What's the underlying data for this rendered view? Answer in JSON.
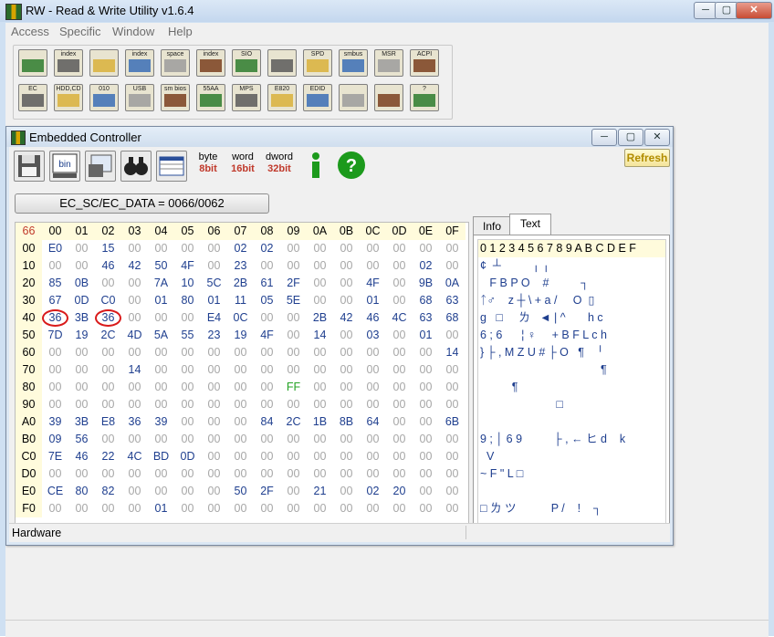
{
  "window": {
    "title": "RW - Read & Write Utility v1.6.4",
    "min_label": "▭",
    "max_label": "▢",
    "close_label": "✕"
  },
  "menu": {
    "items": [
      "Access",
      "Specific",
      "Window",
      "Help"
    ]
  },
  "toolbar": {
    "row1": [
      {
        "icon": "pci-card-icon",
        "label": ""
      },
      {
        "icon": "pci-index-icon",
        "label": "index"
      },
      {
        "icon": "memory-icon",
        "label": ""
      },
      {
        "icon": "memory-index-icon",
        "label": "index"
      },
      {
        "icon": "io-space-icon",
        "label": "space"
      },
      {
        "icon": "io-index-icon",
        "label": "index"
      },
      {
        "icon": "sio-icon",
        "label": "SIO"
      },
      {
        "icon": "oscilloscope-icon",
        "label": ""
      },
      {
        "icon": "spd-icon",
        "label": "SPD"
      },
      {
        "icon": "smbus-icon",
        "label": "smbus"
      },
      {
        "icon": "msr-icon",
        "label": "MSR"
      },
      {
        "icon": "acpi-icon",
        "label": "ACPI"
      }
    ],
    "row2": [
      {
        "icon": "ec-icon",
        "label": "EC"
      },
      {
        "icon": "hdd-cd-icon",
        "label": "HDD,CD"
      },
      {
        "icon": "disk-010-icon",
        "label": "010"
      },
      {
        "icon": "usb-icon",
        "label": "USB"
      },
      {
        "icon": "smbios-icon",
        "label": "sm bios"
      },
      {
        "icon": "55aa-icon",
        "label": "55AA"
      },
      {
        "icon": "mps-icon",
        "label": "MPS"
      },
      {
        "icon": "e820-icon",
        "label": "E820"
      },
      {
        "icon": "edid-icon",
        "label": "EDID"
      },
      {
        "icon": "command-icon",
        "label": ""
      },
      {
        "icon": "hardware-icon",
        "label": ""
      },
      {
        "icon": "help-icon",
        "label": "?"
      }
    ]
  },
  "child": {
    "title": "Embedded Controller",
    "refresh_label": "Refresh",
    "size_buttons": [
      {
        "top": "byte",
        "bottom": "8bit",
        "color": "#c0392b"
      },
      {
        "top": "word",
        "bottom": "16bit",
        "color": "#c0392b"
      },
      {
        "top": "dword",
        "bottom": "32bit",
        "color": "#c0392b"
      }
    ],
    "ec_label": "EC_SC/EC_DATA = 0066/0062",
    "tabs": [
      "Info",
      "Text"
    ],
    "active_tab": "Text",
    "status": "Hardware"
  },
  "grid": {
    "corner": "66",
    "columns": [
      "00",
      "01",
      "02",
      "03",
      "04",
      "05",
      "06",
      "07",
      "08",
      "09",
      "0A",
      "0B",
      "0C",
      "0D",
      "0E",
      "0F"
    ],
    "rows": [
      {
        "addr": "00",
        "cells": [
          "E0",
          "00",
          "15",
          "00",
          "00",
          "00",
          "00",
          "02",
          "02",
          "00",
          "00",
          "00",
          "00",
          "00",
          "00",
          "00"
        ]
      },
      {
        "addr": "10",
        "cells": [
          "00",
          "00",
          "46",
          "42",
          "50",
          "4F",
          "00",
          "23",
          "00",
          "00",
          "00",
          "00",
          "00",
          "00",
          "02",
          "00"
        ]
      },
      {
        "addr": "20",
        "cells": [
          "85",
          "0B",
          "00",
          "00",
          "7A",
          "10",
          "5C",
          "2B",
          "61",
          "2F",
          "00",
          "00",
          "4F",
          "00",
          "9B",
          "0A"
        ]
      },
      {
        "addr": "30",
        "cells": [
          "67",
          "0D",
          "C0",
          "00",
          "01",
          "80",
          "01",
          "11",
          "05",
          "5E",
          "00",
          "00",
          "01",
          "00",
          "68",
          "63"
        ]
      },
      {
        "addr": "40",
        "cells": [
          "36",
          "3B",
          "36",
          "00",
          "00",
          "00",
          "E4",
          "0C",
          "00",
          "00",
          "2B",
          "42",
          "46",
          "4C",
          "63",
          "68"
        ]
      },
      {
        "addr": "50",
        "cells": [
          "7D",
          "19",
          "2C",
          "4D",
          "5A",
          "55",
          "23",
          "19",
          "4F",
          "00",
          "14",
          "00",
          "03",
          "00",
          "01",
          "00"
        ]
      },
      {
        "addr": "60",
        "cells": [
          "00",
          "00",
          "00",
          "00",
          "00",
          "00",
          "00",
          "00",
          "00",
          "00",
          "00",
          "00",
          "00",
          "00",
          "00",
          "14"
        ]
      },
      {
        "addr": "70",
        "cells": [
          "00",
          "00",
          "00",
          "14",
          "00",
          "00",
          "00",
          "00",
          "00",
          "00",
          "00",
          "00",
          "00",
          "00",
          "00",
          "00"
        ]
      },
      {
        "addr": "80",
        "cells": [
          "00",
          "00",
          "00",
          "00",
          "00",
          "00",
          "00",
          "00",
          "00",
          "FF",
          "00",
          "00",
          "00",
          "00",
          "00",
          "00"
        ]
      },
      {
        "addr": "90",
        "cells": [
          "00",
          "00",
          "00",
          "00",
          "00",
          "00",
          "00",
          "00",
          "00",
          "00",
          "00",
          "00",
          "00",
          "00",
          "00",
          "00"
        ]
      },
      {
        "addr": "A0",
        "cells": [
          "39",
          "3B",
          "E8",
          "36",
          "39",
          "00",
          "00",
          "00",
          "84",
          "2C",
          "1B",
          "8B",
          "64",
          "00",
          "00",
          "6B"
        ]
      },
      {
        "addr": "B0",
        "cells": [
          "09",
          "56",
          "00",
          "00",
          "00",
          "00",
          "00",
          "00",
          "00",
          "00",
          "00",
          "00",
          "00",
          "00",
          "00",
          "00"
        ]
      },
      {
        "addr": "C0",
        "cells": [
          "7E",
          "46",
          "22",
          "4C",
          "BD",
          "0D",
          "00",
          "00",
          "00",
          "00",
          "00",
          "00",
          "00",
          "00",
          "00",
          "00"
        ]
      },
      {
        "addr": "D0",
        "cells": [
          "00",
          "00",
          "00",
          "00",
          "00",
          "00",
          "00",
          "00",
          "00",
          "00",
          "00",
          "00",
          "00",
          "00",
          "00",
          "00"
        ]
      },
      {
        "addr": "E0",
        "cells": [
          "CE",
          "80",
          "82",
          "00",
          "00",
          "00",
          "00",
          "50",
          "2F",
          "00",
          "21",
          "00",
          "02",
          "20",
          "00",
          "00"
        ]
      },
      {
        "addr": "F0",
        "cells": [
          "00",
          "00",
          "00",
          "00",
          "01",
          "00",
          "00",
          "00",
          "00",
          "00",
          "00",
          "00",
          "00",
          "00",
          "00",
          "00"
        ]
      }
    ],
    "highlight_color": "#24a324",
    "circle_color": "#d91a1a"
  },
  "text_panel": {
    "header": "0 1 2 3 4 5 6 7 8 9 A B C D E F",
    "rows": [
      "¢  ┴          ╷ ╷",
      "   F B P O    #          ┐",
      "ᛏ♂    z ┼ \\ + a /     O  ▯",
      "g   □     ㄌ   ◄ | ^       h c",
      "6 ; 6      ¦ ♀     + B F L c h",
      "} ├ , M Z U # ├ O   ¶    ╵",
      "                                      ¶",
      "          ¶",
      "                        □",
      "",
      "9 ; │ 6 9          ├ , ← ヒ d    k",
      "  V",
      "~ F \" L □",
      "",
      "□ ㄌ ツ           P /    !    ┐",
      ""
    ]
  }
}
